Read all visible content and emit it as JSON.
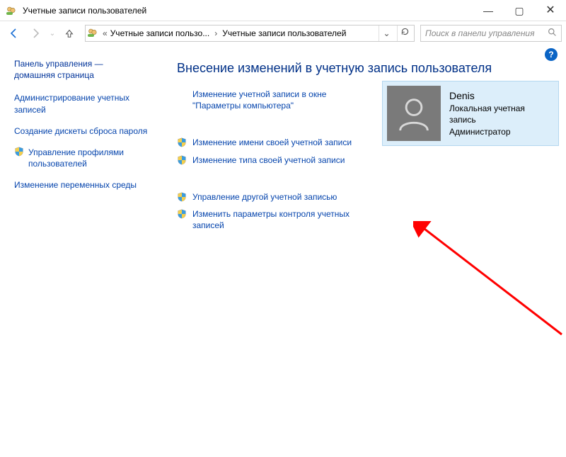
{
  "window": {
    "title": "Учетные записи пользователей"
  },
  "breadcrumbs": {
    "item1": "Учетные записи пользо...",
    "item2": "Учетные записи пользователей"
  },
  "search": {
    "placeholder": "Поиск в панели управления"
  },
  "sidebar": {
    "cp_home_line1": "Панель управления —",
    "cp_home_line2": "домашняя страница",
    "link_admin_accounts": "Администрирование учетных записей",
    "link_create_reset_disk": "Создание дискеты сброса пароля",
    "link_manage_profiles": "Управление профилями пользователей",
    "link_env_vars": "Изменение переменных среды"
  },
  "main": {
    "heading": "Внесение изменений в учетную запись пользователя",
    "actions": {
      "change_in_settings": "Изменение учетной записи в окне \"Параметры компьютера\"",
      "change_name": "Изменение имени своей учетной записи",
      "change_type": "Изменение типа своей учетной записи",
      "manage_other": "Управление другой учетной записью",
      "uac_settings": "Изменить параметры контроля учетных записей"
    }
  },
  "user": {
    "name": "Denis",
    "account_kind": "Локальная учетная запись",
    "role": "Администратор"
  }
}
